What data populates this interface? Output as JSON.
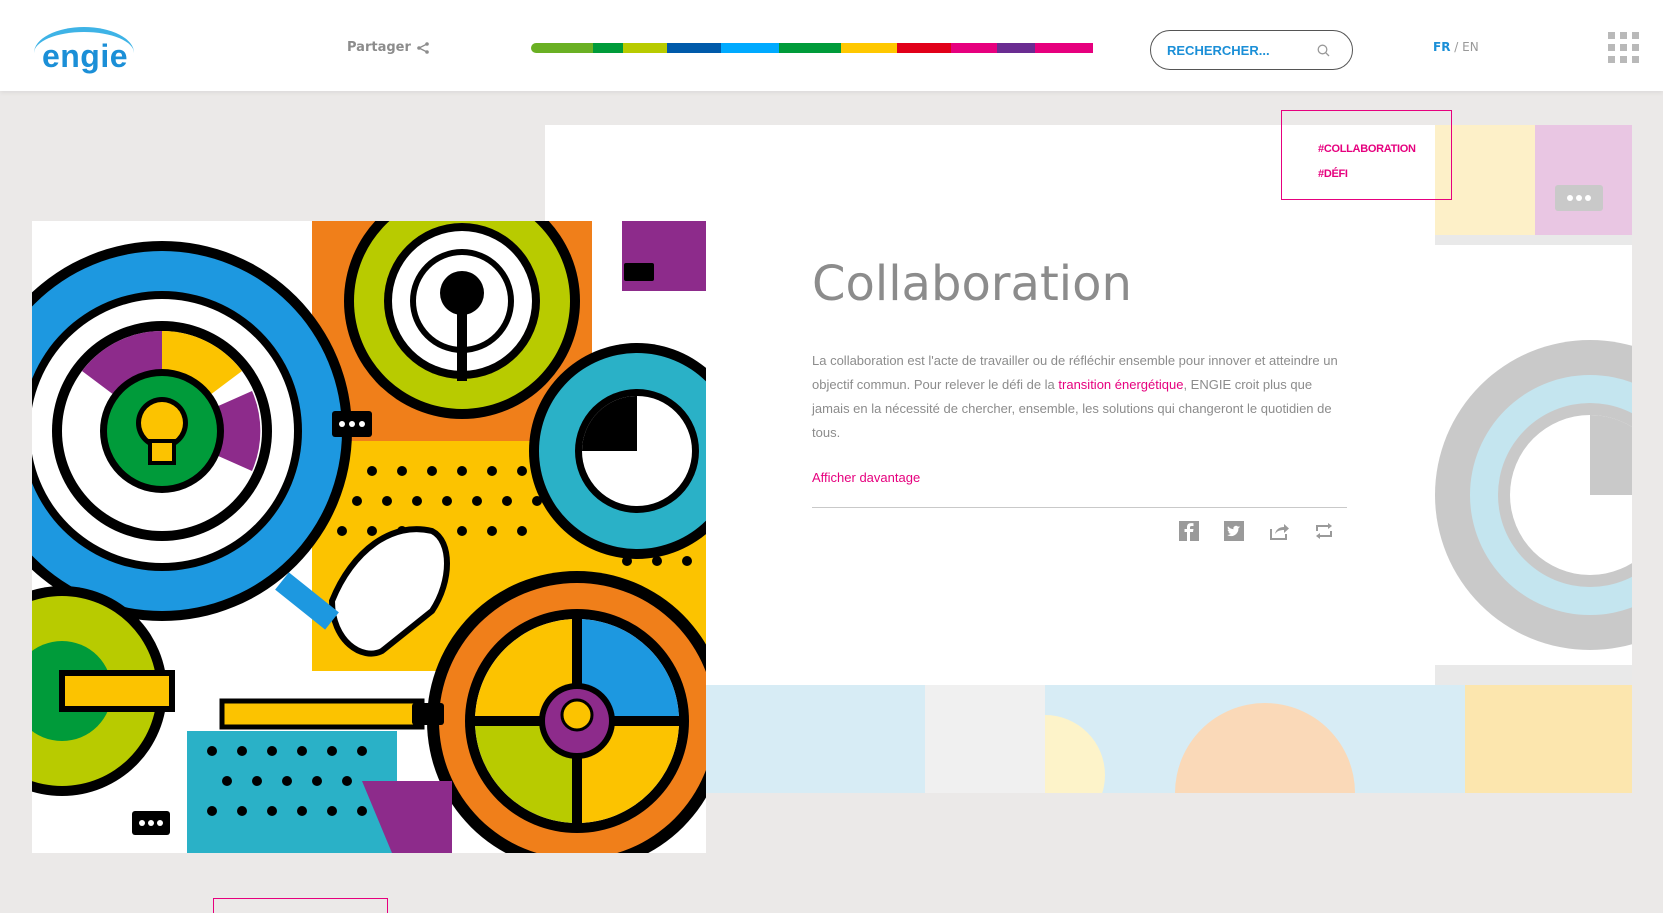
{
  "header": {
    "logo_text": "ENGIE",
    "share_label": "Partager",
    "colorbar": [
      "#6ab023",
      "#009b3a",
      "#b8cb00",
      "#005aaa",
      "#00aaff",
      "#009b3a",
      "#ffc800",
      "#e10019",
      "#e6007e",
      "#6a2c91",
      "#e6007e"
    ],
    "search_placeholder": "RECHERCHER...",
    "lang_fr": "FR",
    "lang_sep": "/",
    "lang_en": "EN"
  },
  "tags": [
    "#COLLABORATION",
    "#DÉFI"
  ],
  "article": {
    "title": "Collaboration",
    "desc_part1": "La collaboration est l'acte de travailler ou de réfléchir ensemble pour innover et atteindre un objectif commun. Pour relever le défi de la ",
    "desc_link": "transition énergétique",
    "desc_part2": ", ENGIE croit plus que jamais en la nécessité de chercher, ensemble, les solutions qui changeront le quotidien de tous.",
    "more_label": "Afficher davantage"
  },
  "social": [
    "facebook-icon",
    "twitter-icon",
    "share-icon",
    "retweet-icon"
  ],
  "colors": {
    "accent": "#e6007e",
    "brand": "#1b8fd7"
  }
}
